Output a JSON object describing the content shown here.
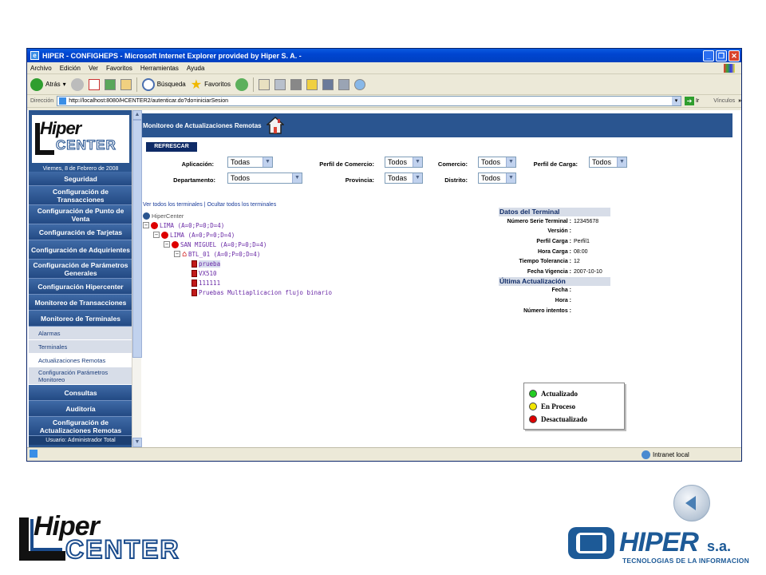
{
  "window": {
    "title": "HIPER - CONFIGHEPS - Microsoft Internet Explorer provided by Hiper S. A. -",
    "menu": [
      "Archivo",
      "Edición",
      "Ver",
      "Favoritos",
      "Herramientas",
      "Ayuda"
    ],
    "toolbar": {
      "back": "Atrás",
      "search": "Búsqueda",
      "favorites": "Favoritos"
    },
    "address_label": "Dirección",
    "address_url": "http://localhost:8080/HCENTER2/autenticar.do?do=iniciarSesion",
    "go_label": "Ir",
    "links_label": "Vínculos",
    "status_zone": "Intranet local"
  },
  "sidebar": {
    "date": "Viernes, 8 de Febrero de 2008",
    "items": [
      "Seguridad",
      "Configuración de Transacciones",
      "Configuración de Punto de Venta",
      "Configuración de Tarjetas",
      "Configuración de Adquirientes",
      "Configuración de Parámetros Generales",
      "Configuración Hipercenter",
      "Monitoreo de Transacciones",
      "Monitoreo de Terminales"
    ],
    "subitems": [
      "Alarmas",
      "Terminales",
      "Actualizaciones Remotas",
      "Configuración Parámetros Monitoreo"
    ],
    "items_after": [
      "Consultas",
      "Auditoría",
      "Configuración de Actualizaciones Remotas"
    ],
    "user": "Usuario: Administrador Total"
  },
  "main": {
    "header_title": "Monitoreo de Actualizaciones Remotas",
    "refresh_label": "REFRESCAR",
    "filters": {
      "aplicacion_label": "Aplicación:",
      "aplicacion_value": "Todas",
      "perfil_comercio_label": "Perfil de Comercio:",
      "perfil_comercio_value": "Todos",
      "comercio_label": "Comercio:",
      "comercio_value": "Todos",
      "perfil_carga_label": "Perfil de Carga:",
      "perfil_carga_value": "Todos",
      "departamento_label": "Departamento:",
      "departamento_value": "Todos",
      "provincia_label": "Provincia:",
      "provincia_value": "Todas",
      "distrito_label": "Distrito:",
      "distrito_value": "Todos"
    },
    "show_all": "Ver todos los terminales",
    "separator": "|",
    "hide_all": "Ocultar todos los terminales",
    "tree": {
      "root": "HiperCenter",
      "n1": "LIMA (A=0;P=0;D=4)",
      "n2": "LIMA (A=0;P=0;D=4)",
      "n3": "SAN MIGUEL (A=0;P=0;D=4)",
      "n4": "BTL_01 (A=0;P=0;D=4)",
      "t1": "prueba",
      "t2": "VX510",
      "t3": "111111",
      "t4": "Pruebas Multiaplicacion flujo binario"
    },
    "details": {
      "title": "Datos del Terminal",
      "rows": [
        {
          "k": "Número Serie Terminal :",
          "v": "12345678"
        },
        {
          "k": "Versión :",
          "v": ""
        },
        {
          "k": "Perfil Carga :",
          "v": "Perfil1"
        },
        {
          "k": "Hora Carga :",
          "v": "08:00"
        },
        {
          "k": "Tiempo Tolerancia :",
          "v": "12"
        },
        {
          "k": "Fecha Vigencia :",
          "v": "2007-10-10"
        }
      ],
      "update_title": "Última Actualización",
      "update_rows": [
        {
          "k": "Fecha :",
          "v": ""
        },
        {
          "k": "Hora :",
          "v": ""
        },
        {
          "k": "Número intentos :",
          "v": ""
        }
      ]
    },
    "legend": [
      {
        "label": "Actualizado",
        "color": "#22cc22"
      },
      {
        "label": "En Proceso",
        "color": "#f2e600"
      },
      {
        "label": "Desactualizado",
        "color": "#dd0000"
      }
    ]
  },
  "brand": {
    "logo_left_top": "Hiper",
    "logo_left_bottom": "CENTER",
    "logo_right": "HIPER",
    "logo_right_suffix": "s.a.",
    "logo_right_tagline": "TECNOLOGIAS DE LA INFORMACION"
  }
}
